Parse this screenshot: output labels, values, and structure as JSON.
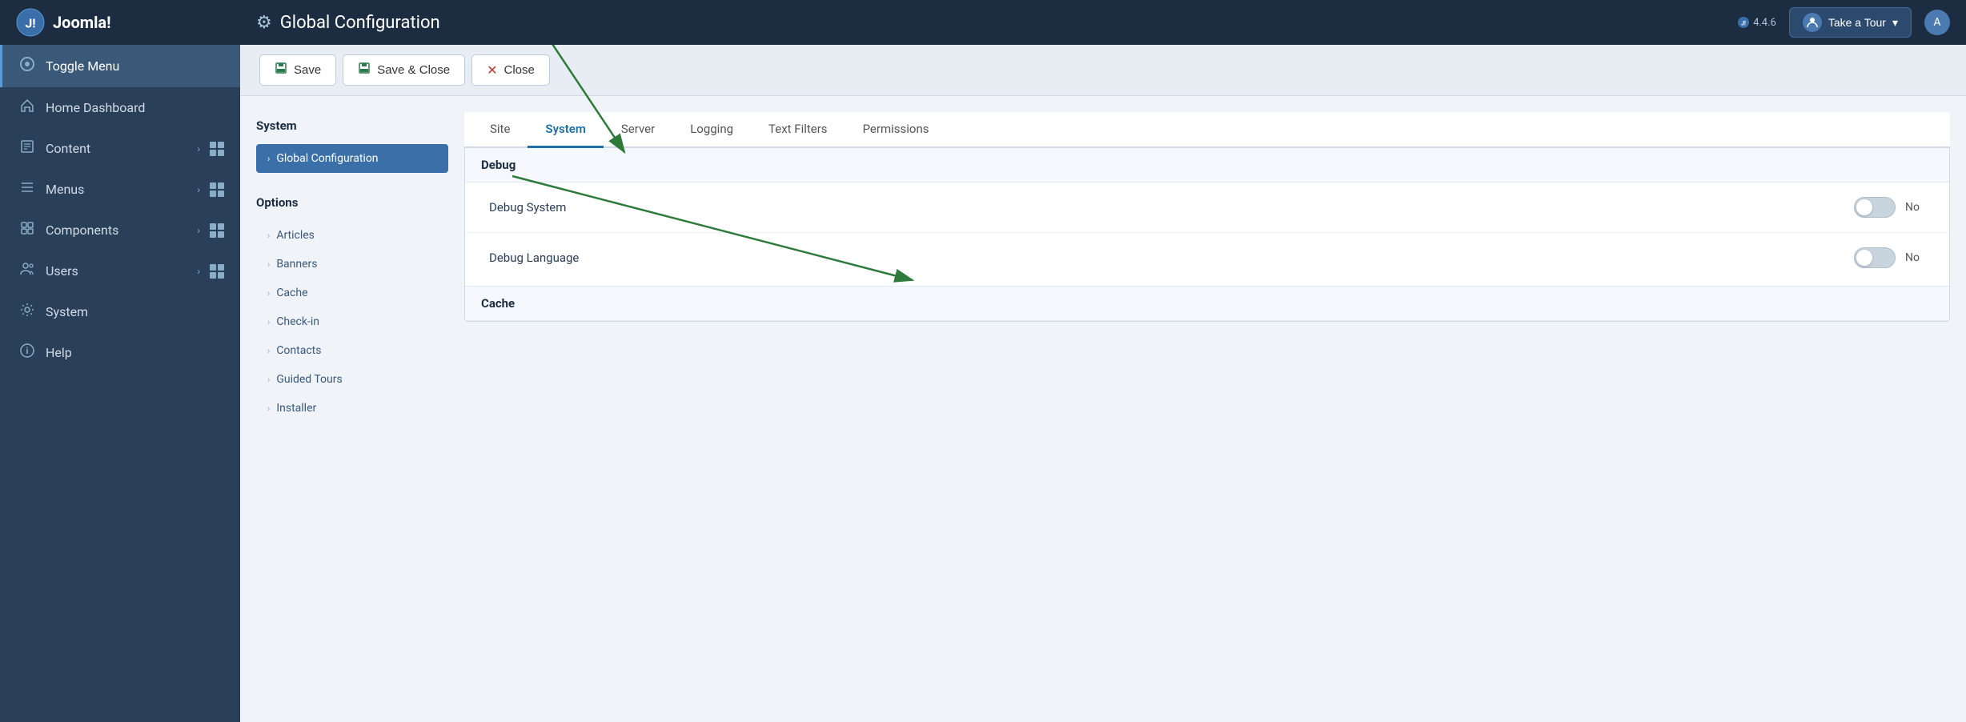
{
  "header": {
    "logo_text": "Joomla!",
    "title": "Global Configuration",
    "version": "4.4.6",
    "take_tour_label": "Take a Tour"
  },
  "sidebar": {
    "toggle_label": "Toggle Menu",
    "items": [
      {
        "id": "home-dashboard",
        "label": "Home Dashboard",
        "icon": "home",
        "has_chevron": false,
        "has_grid": false
      },
      {
        "id": "content",
        "label": "Content",
        "icon": "file",
        "has_chevron": true,
        "has_grid": true
      },
      {
        "id": "menus",
        "label": "Menus",
        "icon": "list",
        "has_chevron": true,
        "has_grid": true
      },
      {
        "id": "components",
        "label": "Components",
        "icon": "puzzle",
        "has_chevron": true,
        "has_grid": true
      },
      {
        "id": "users",
        "label": "Users",
        "icon": "users",
        "has_chevron": true,
        "has_grid": true
      },
      {
        "id": "system",
        "label": "System",
        "icon": "wrench",
        "has_chevron": false,
        "has_grid": false
      },
      {
        "id": "help",
        "label": "Help",
        "icon": "info",
        "has_chevron": false,
        "has_grid": false
      }
    ]
  },
  "toolbar": {
    "save_label": "Save",
    "save_close_label": "Save & Close",
    "close_label": "Close"
  },
  "left_panel": {
    "system_title": "System",
    "system_items": [
      {
        "id": "global-configuration",
        "label": "Global Configuration",
        "active": true
      }
    ],
    "options_title": "Options",
    "options_items": [
      {
        "id": "articles",
        "label": "Articles"
      },
      {
        "id": "banners",
        "label": "Banners"
      },
      {
        "id": "cache",
        "label": "Cache"
      },
      {
        "id": "check-in",
        "label": "Check-in"
      },
      {
        "id": "contacts",
        "label": "Contacts"
      },
      {
        "id": "guided-tours",
        "label": "Guided Tours"
      },
      {
        "id": "installer",
        "label": "Installer"
      }
    ]
  },
  "tabs": [
    {
      "id": "site",
      "label": "Site",
      "active": false
    },
    {
      "id": "system",
      "label": "System",
      "active": true
    },
    {
      "id": "server",
      "label": "Server",
      "active": false
    },
    {
      "id": "logging",
      "label": "Logging",
      "active": false
    },
    {
      "id": "text-filters",
      "label": "Text Filters",
      "active": false
    },
    {
      "id": "permissions",
      "label": "Permissions",
      "active": false
    }
  ],
  "debug_section": {
    "title": "Debug",
    "rows": [
      {
        "id": "debug-system",
        "label": "Debug System",
        "value": "No",
        "toggled": false
      },
      {
        "id": "debug-language",
        "label": "Debug Language",
        "value": "No",
        "toggled": false
      }
    ]
  },
  "cache_section": {
    "title": "Cache"
  },
  "colors": {
    "sidebar_bg": "#2a3f58",
    "header_bg": "#1c2d42",
    "active_tab": "#1c6fa8",
    "active_nav_item": "#3a6fa8",
    "arrow_color": "#2d7a3a"
  }
}
